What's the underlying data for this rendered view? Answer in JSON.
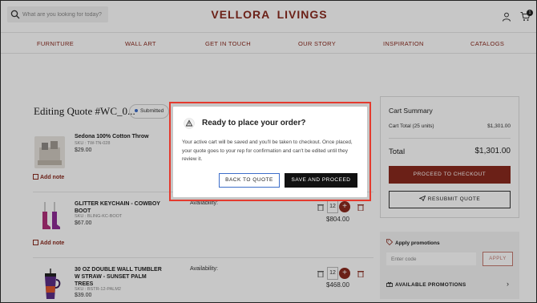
{
  "header": {
    "search_placeholder": "What are you looking for today?",
    "logo": "VELLORA LIVINGS",
    "cart_count": "1"
  },
  "nav": {
    "items": [
      "FURNITURE",
      "WALL ART",
      "GET IN TOUCH",
      "OUR STORY",
      "INSPIRATION",
      "CATALOGS"
    ]
  },
  "quote": {
    "title": "Editing Quote #WC_0...",
    "status": "Submitted"
  },
  "items": [
    {
      "name": "Sedona 100% Cotton Throw",
      "sku": "SKU : TW-TN-028",
      "price": "$29.00",
      "add_note": "Add note"
    },
    {
      "name": "GLITTER KEYCHAIN - COWBOY BOOT",
      "sku": "SKU : BLING-KC-BOOT",
      "price": "$67.00",
      "availability": "Availability:",
      "qty": "12",
      "line_total": "$804.00",
      "add_note": "Add note"
    },
    {
      "name": "30 OZ DOUBLE WALL TUMBLER W STRAW - SUNSET PALM TREES",
      "sku": "SKU : BSTR-12-PALM2",
      "price": "$39.00",
      "availability": "Availability:",
      "qty": "12",
      "line_total": "$468.00"
    }
  ],
  "summary": {
    "title": "Cart Summary",
    "cart_total_label": "Cart Total (25 units)",
    "cart_total_value": "$1,301.00",
    "total_label": "Total",
    "total_value": "$1,301.00",
    "checkout_label": "PROCEED TO CHECKOUT",
    "resubmit_label": "RESUBMIT QUOTE"
  },
  "promotions": {
    "title": "Apply promotions",
    "code_placeholder": "Enter code",
    "apply_label": "APPLY",
    "available_label": "AVAILABLE PROMOTIONS"
  },
  "modal": {
    "title": "Ready to place your order?",
    "body": "Your active cart will be saved and you'll be taken to checkout. Once placed, your quote goes to your rep for confirmation and can't be edited until they review it.",
    "back_label": "BACK TO QUOTE",
    "proceed_label": "SAVE AND PROCEED"
  },
  "colors": {
    "brand": "#8a2a1e",
    "highlight": "#e43a2e",
    "accent_blue": "#3d6ec9"
  }
}
